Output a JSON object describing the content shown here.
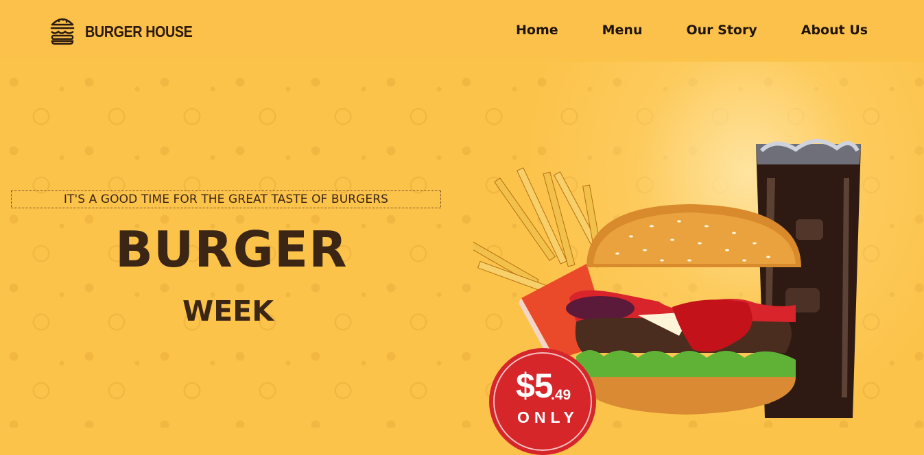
{
  "brand": {
    "name": "BURGER HOUSE",
    "logo_icon": "burger-icon",
    "color": "#2c1a0e"
  },
  "nav": {
    "items": [
      {
        "label": "Home"
      },
      {
        "label": "Menu"
      },
      {
        "label": "Our Story"
      },
      {
        "label": "About Us"
      }
    ]
  },
  "hero": {
    "tagline": "IT'S A GOOD TIME FOR THE GREAT TASTE OF BURGERS",
    "title": "BURGER",
    "subtitle": "WEEK",
    "accent": "#fcc34a"
  },
  "promo": {
    "price_main": "$5",
    "price_cents": ".49",
    "only": "ONLY",
    "badge_color": "#d6262a"
  }
}
